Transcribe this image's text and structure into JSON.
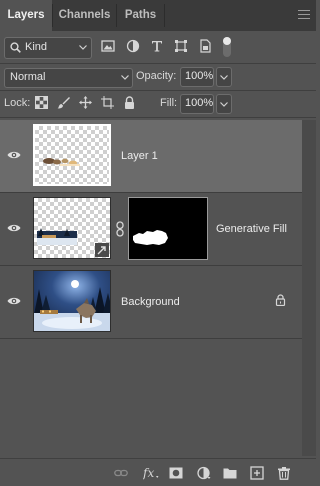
{
  "tabs": [
    {
      "label": "Layers",
      "active": true
    },
    {
      "label": "Channels",
      "active": false
    },
    {
      "label": "Paths",
      "active": false
    }
  ],
  "filter": {
    "kind_label": "Kind",
    "icons": [
      "image-filter-icon",
      "adjustment-filter-icon",
      "type-filter-icon",
      "shape-filter-icon",
      "smart-object-filter-icon"
    ]
  },
  "blend_mode": "Normal",
  "opacity": {
    "label": "Opacity:",
    "value": "100%"
  },
  "lock": {
    "label": "Lock:"
  },
  "fill": {
    "label": "Fill:",
    "value": "100%"
  },
  "layers": [
    {
      "name": "Layer 1",
      "selected": true,
      "visible": true
    },
    {
      "name": "Generative Fill",
      "selected": false,
      "visible": true,
      "has_mask": true
    },
    {
      "name": "Background",
      "selected": false,
      "visible": true,
      "locked": true
    }
  ],
  "colors": {
    "panel": "#535353",
    "selected_row": "#6b6b6b",
    "tab_bar": "#3a3a3a"
  }
}
